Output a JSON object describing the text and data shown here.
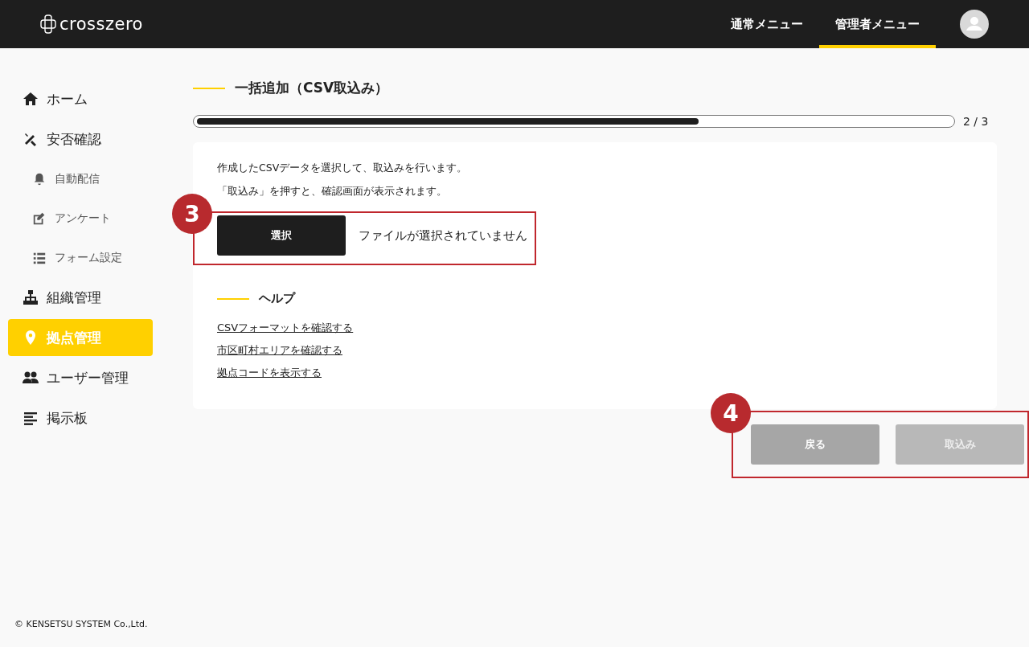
{
  "header": {
    "logo": "crosszero",
    "nav": [
      {
        "label": "通常メニュー",
        "selected": false
      },
      {
        "label": "管理者メニュー",
        "selected": true
      }
    ]
  },
  "sidebar": {
    "items": [
      {
        "label": "ホーム",
        "kind": "main",
        "selected": false
      },
      {
        "label": "安否確認",
        "kind": "main",
        "selected": false
      },
      {
        "label": "自動配信",
        "kind": "sub",
        "selected": false
      },
      {
        "label": "アンケート",
        "kind": "sub",
        "selected": false
      },
      {
        "label": "フォーム設定",
        "kind": "sub",
        "selected": false
      },
      {
        "label": "組織管理",
        "kind": "main",
        "selected": false
      },
      {
        "label": "拠点管理",
        "kind": "main",
        "selected": true
      },
      {
        "label": "ユーザー管理",
        "kind": "main",
        "selected": false
      },
      {
        "label": "掲示板",
        "kind": "main",
        "selected": false
      }
    ]
  },
  "page": {
    "title": "一括追加（CSV取込み）",
    "progress": {
      "level": 0.665,
      "reading": "2 / 3"
    },
    "instructions": [
      "作成したCSVデータを選択して、取込みを行います。",
      "「取込み」を押すと、確認画面が表示されます。"
    ],
    "file_picker": {
      "callout": "3",
      "button": "選択",
      "status": "ファイルが選択されていません"
    },
    "help": {
      "title": "ヘルプ",
      "links": [
        "CSVフォーマットを確認する",
        "市区町村エリアを確認する",
        "拠点コードを表示する"
      ]
    },
    "actions": {
      "callout": "4",
      "buttons": [
        {
          "label": "戻る",
          "disabled": false
        },
        {
          "label": "取込み",
          "disabled": true
        }
      ]
    }
  },
  "footer": "© KENSETSU SYSTEM Co.,Ltd."
}
